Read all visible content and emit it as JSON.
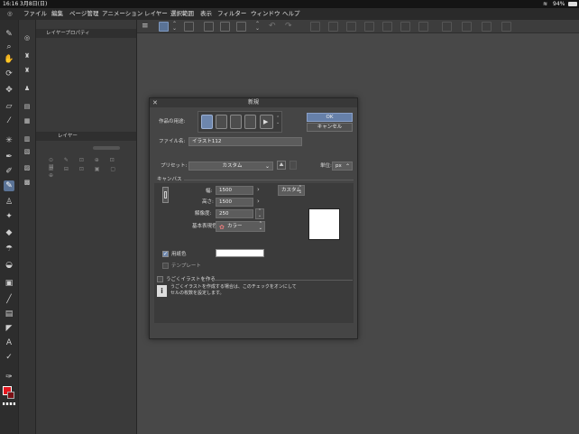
{
  "status": {
    "time": "16:16",
    "date": "3月8日(日)",
    "battery": "94%"
  },
  "menu": [
    "ファイル",
    "編集",
    "ページ管理",
    "アニメーション",
    "レイヤー",
    "選択範囲",
    "表示",
    "フィルター",
    "ウィンドウ",
    "ヘルプ"
  ],
  "panels": {
    "layer_property": "レイヤープロパティ",
    "layer": "レイヤー"
  },
  "dialog": {
    "title": "新規",
    "purpose_label": "作品の用途:",
    "ok": "OK",
    "cancel": "キャンセル",
    "filename_label": "ファイル名:",
    "filename_value": "イラスト112",
    "preset_label": "プリセット:",
    "preset_value": "カスタム",
    "unit_label": "単位:",
    "unit_value": "px",
    "canvas_section": "キャンバス",
    "width_label": "幅:",
    "width_value": "1500",
    "height_label": "高さ:",
    "height_value": "1500",
    "size_preset": "カスタム",
    "resolution_label": "解像度:",
    "resolution_value": "250",
    "color_label": "基本表現色:",
    "color_value": "カラー",
    "paper_label": "用紙色",
    "template_label": "テンプレート",
    "anim_label": "うごくイラストを作る",
    "anim_help_1": "うごくイラストを作成する場合は、このチェックをオンにして",
    "anim_help_2": "セルの枚数を設定します。"
  },
  "colors": {
    "main_color": "#e3161e",
    "accent": "#5a7396"
  }
}
